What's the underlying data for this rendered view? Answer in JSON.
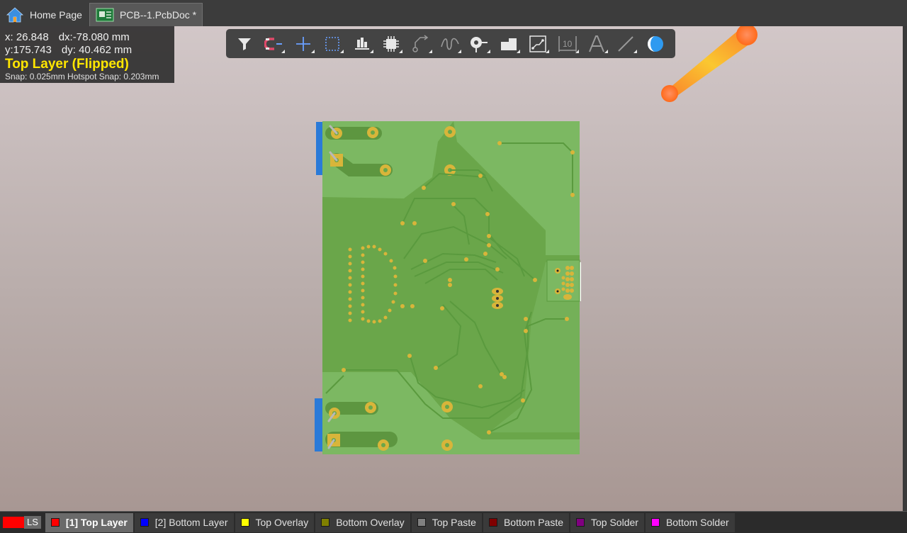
{
  "tabs": [
    {
      "label": "Home Page",
      "icon": "home-icon"
    },
    {
      "label": "PCB--1.PcbDoc *",
      "icon": "pcb-doc-icon"
    }
  ],
  "hud": {
    "x": "x: 26.848",
    "dx": "dx:-78.080 mm",
    "y": "y:175.743",
    "dy": "dy: 40.462 mm",
    "layer": "Top Layer (Flipped)",
    "snap": "Snap: 0.025mm Hotspot Snap: 0.203mm"
  },
  "toolbar": {
    "tools": [
      "filter-icon",
      "snap-magnet-icon",
      "move-cross-icon",
      "select-rect-icon",
      "align-icon",
      "component-icon",
      "route-icon",
      "tune-length-icon",
      "via-icon",
      "polygon-fill-icon",
      "diff-pair-icon",
      "dimension-icon",
      "text-icon",
      "line-icon",
      "layer-toggle-icon"
    ],
    "dimension_label": "10"
  },
  "layers": {
    "ls_label": "LS",
    "ls_color": "#ff0000",
    "items": [
      {
        "label": "[1] Top Layer",
        "color": "#ff0000",
        "active": true
      },
      {
        "label": "[2] Bottom Layer",
        "color": "#0000ff",
        "active": false
      },
      {
        "label": "Top Overlay",
        "color": "#ffff00",
        "active": false
      },
      {
        "label": "Bottom Overlay",
        "color": "#808000",
        "active": false
      },
      {
        "label": "Top Paste",
        "color": "#808080",
        "active": false
      },
      {
        "label": "Bottom Paste",
        "color": "#800000",
        "active": false
      },
      {
        "label": "Top Solder",
        "color": "#800080",
        "active": false
      },
      {
        "label": "Bottom Solder",
        "color": "#ff00ff",
        "active": false
      }
    ]
  },
  "colors": {
    "board_green": "#6aa64a",
    "board_light": "#7cb862",
    "pad": "#d8b53a"
  }
}
